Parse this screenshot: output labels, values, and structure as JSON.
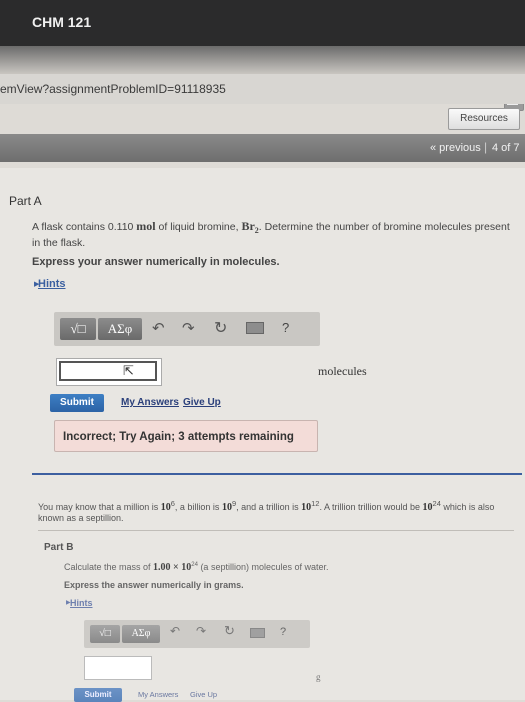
{
  "browser": {
    "tab_title": "CHM 121",
    "url_fragment": "emView?assignmentProblemID=91118935"
  },
  "header": {
    "resources_label": "Resources",
    "previous_label": "« previous",
    "separator": "|",
    "page_indicator": "4 of 7"
  },
  "partA": {
    "title": "Part A",
    "question_pre": "A flask contains 0.110 ",
    "question_unit": "mol",
    "question_mid": " of liquid bromine, ",
    "question_formula": "Br",
    "question_formula_sub": "2",
    "question_post": ". Determine the number of bromine molecules present in the flask.",
    "instruction": "Express your answer numerically in molecules.",
    "hints_label": "Hints",
    "toolbar": {
      "template_label": "√□",
      "symbols_label": "ΑΣφ",
      "help_label": "?"
    },
    "answer_value": "",
    "units": "molecules",
    "submit_label": "Submit",
    "my_answers_label": "My Answers",
    "give_up_label": "Give Up",
    "feedback": "Incorrect; Try Again; 3 attempts remaining"
  },
  "intro": {
    "t1": "You may know that a million is ",
    "million": "10",
    "million_exp": "6",
    "t2": ", a billion is ",
    "billion": "10",
    "billion_exp": "9",
    "t3": ", and a trillion is ",
    "trillion": "10",
    "trillion_exp": "12",
    "t4": ". A trillion trillion would be ",
    "tt": "10",
    "tt_exp": "24",
    "t5": " which is also known as a septillion."
  },
  "partB": {
    "title": "Part B",
    "question_pre": "Calculate the mass of ",
    "quantity": "1.00 × 10",
    "quantity_exp": "24",
    "question_post": " (a septillion) molecules of water.",
    "instruction": "Express the answer numerically in grams.",
    "hints_label": "Hints",
    "toolbar": {
      "template_label": "√□",
      "symbols_label": "ΑΣφ",
      "help_label": "?"
    },
    "units": "g",
    "submit_label": "Submit",
    "my_answers_label": "My Answers",
    "give_up_label": "Give Up"
  },
  "colors": {
    "submit": "#2c63a6",
    "divider": "#3d5fa0",
    "feedback_bg": "#f3dcd8"
  }
}
